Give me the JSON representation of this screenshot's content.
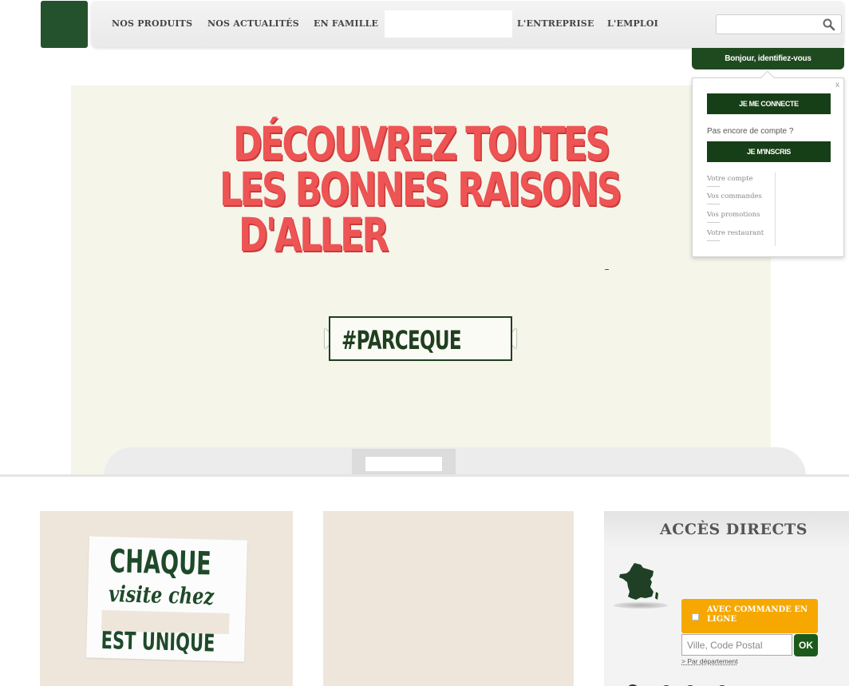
{
  "header": {
    "nav": [
      {
        "label": "NOS PRODUITS"
      },
      {
        "label": "NOS ACTUALITÉS"
      },
      {
        "label": "EN FAMILLE"
      },
      {
        "label": "L'ENTREPRISE"
      },
      {
        "label": "L'EMPLOI"
      }
    ],
    "search": {
      "value": "",
      "placeholder": ""
    }
  },
  "account": {
    "tab_label": "Bonjour, identifiez-vous",
    "close_label": "x",
    "login_label": "JE ME CONNECTE",
    "no_account_text": "Pas encore de compte ?",
    "register_label": "JE M'INSCRIS",
    "links": [
      {
        "label": "Votre compte"
      },
      {
        "label": "Vos commandes"
      },
      {
        "label": "Vos promotions"
      },
      {
        "label": "Votre restaurant"
      }
    ]
  },
  "hero": {
    "title_lines": [
      "DÉCOUVREZ TOUTES",
      "LES BONNES RAISONS",
      "D'ALLER"
    ],
    "tag": "#PARCEQUE"
  },
  "cards": {
    "visit": {
      "line1": "CHAQUE",
      "line2": "visite chez",
      "line3": "EST UNIQUE"
    }
  },
  "access": {
    "title": "ACCÈS DIRECTS",
    "order_label": "AVEC COMMANDE EN LIGNE",
    "order_checked": false,
    "city_placeholder": "Ville, Code Postal",
    "city_value": "",
    "ok_label": "OK",
    "dept_link": "> Par département"
  },
  "colors": {
    "brand_green": "#1f4a1f",
    "hero_red": "#ee5454",
    "order_orange": "#f6a800"
  },
  "icons": [
    "search-icon",
    "france-map-icon",
    "close-icon"
  ]
}
